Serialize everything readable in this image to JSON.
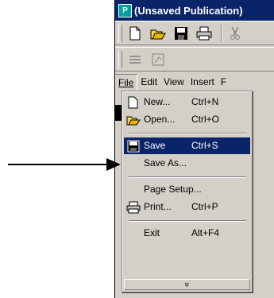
{
  "window": {
    "title": "(Unsaved Publication)"
  },
  "menubar": {
    "items": [
      "File",
      "Edit",
      "View",
      "Insert",
      "F"
    ]
  },
  "file_menu": {
    "items": [
      {
        "label": "New...",
        "shortcut": "Ctrl+N",
        "icon": "new-document-icon"
      },
      {
        "label": "Open...",
        "shortcut": "Ctrl+O",
        "icon": "open-folder-icon"
      },
      {
        "label": "Save",
        "shortcut": "Ctrl+S",
        "icon": "save-disk-icon",
        "selected": true
      },
      {
        "label": "Save As...",
        "shortcut": ""
      },
      {
        "label": "Page Setup...",
        "shortcut": ""
      },
      {
        "label": "Print...",
        "shortcut": "Ctrl+P",
        "icon": "printer-icon"
      },
      {
        "label": "Exit",
        "shortcut": "Alt+F4"
      }
    ],
    "expand_glyph": "»"
  },
  "colors": {
    "title_bar": "#0a246a",
    "menu_bg": "#d4d0c8",
    "selection": "#0a246a"
  }
}
